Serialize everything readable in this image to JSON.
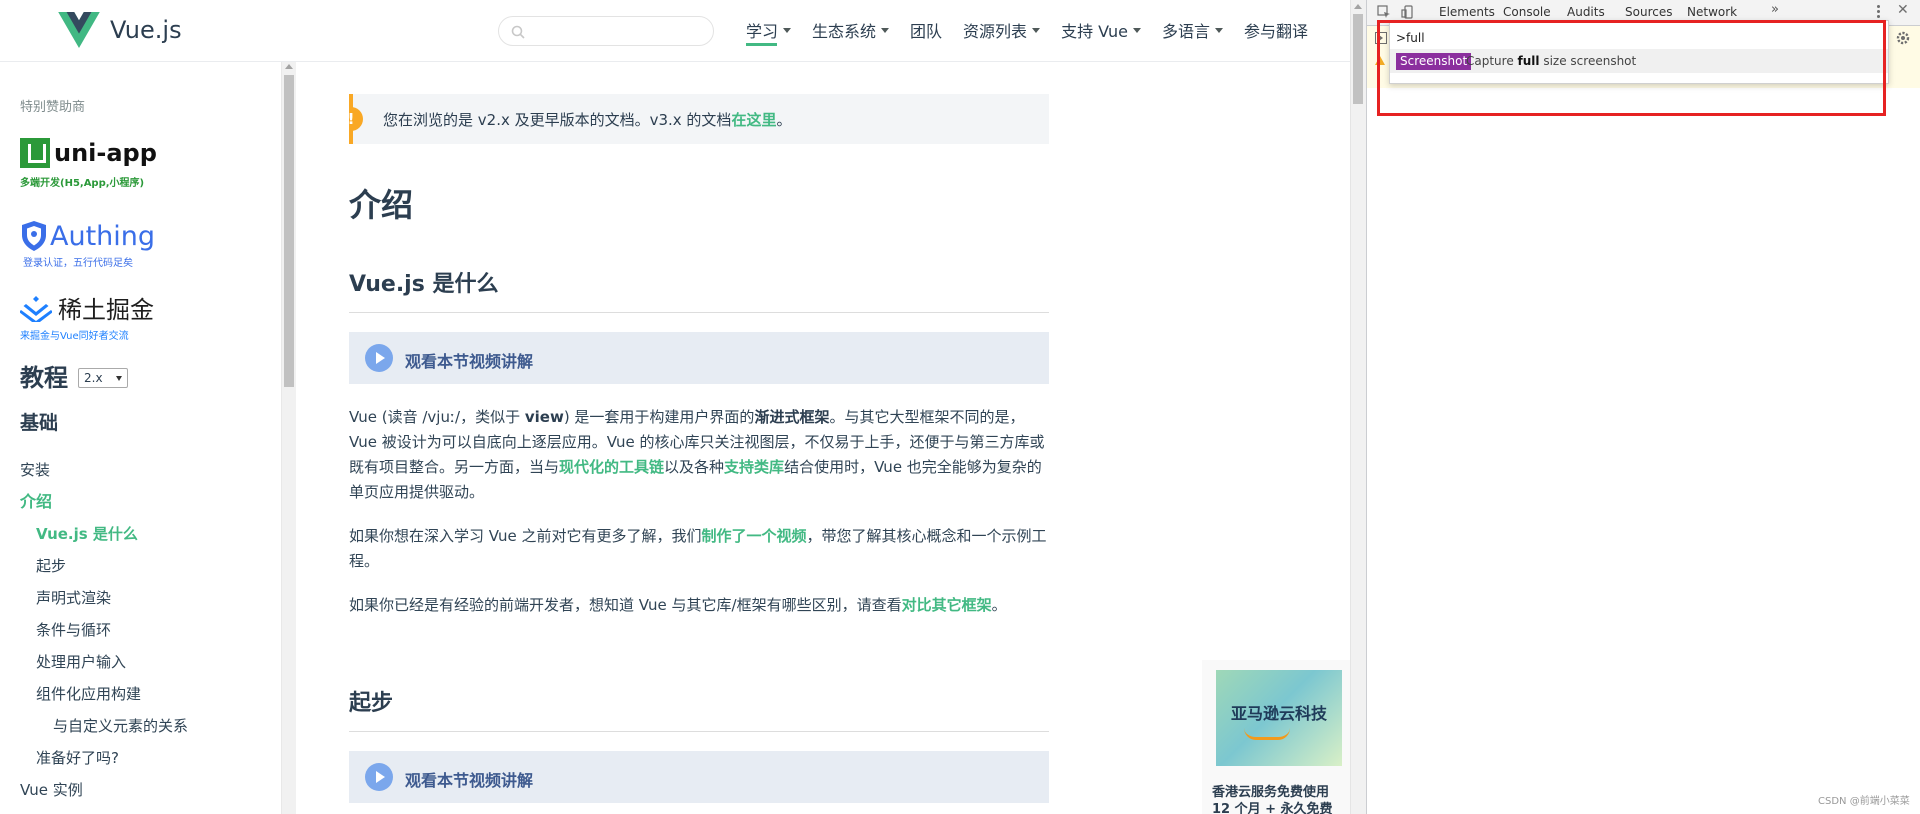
{
  "header": {
    "logo_text": "Vue.js",
    "search": {
      "placeholder": "",
      "value": ""
    },
    "nav": [
      {
        "label": "学习",
        "dropdown": true,
        "active": true
      },
      {
        "label": "生态系统",
        "dropdown": true
      },
      {
        "label": "团队",
        "dropdown": false
      },
      {
        "label": "资源列表",
        "dropdown": true
      },
      {
        "label": "支持 Vue",
        "dropdown": true
      },
      {
        "label": "多语言",
        "dropdown": true
      },
      {
        "label": "参与翻译",
        "dropdown": false
      }
    ]
  },
  "sidebar": {
    "sponsor_heading": "特别赞助商",
    "sponsors": [
      {
        "name": "uni-app",
        "tagline": "多端开发(H5,App,小程序)",
        "icon": "uni-app-logo-icon",
        "color": "#2b9939"
      },
      {
        "name": "Authing",
        "tagline": "登录认证，五行代码足矣",
        "icon": "authing-shield-icon",
        "color": "#3a6ee8"
      },
      {
        "name": "稀土掘金",
        "tagline": "来掘金与Vue同好者交流",
        "icon": "juejin-logo-icon",
        "color": "#1e80ff"
      }
    ],
    "toc_title": "教程",
    "version": "2.x",
    "section": "基础",
    "links": [
      {
        "label": "安装",
        "level": 0,
        "state": ""
      },
      {
        "label": "介绍",
        "level": 0,
        "state": "active"
      },
      {
        "label": "Vue.js 是什么",
        "level": 1,
        "state": "current"
      },
      {
        "label": "起步",
        "level": 1,
        "state": ""
      },
      {
        "label": "声明式渲染",
        "level": 1,
        "state": ""
      },
      {
        "label": "条件与循环",
        "level": 1,
        "state": ""
      },
      {
        "label": "处理用户输入",
        "level": 1,
        "state": ""
      },
      {
        "label": "组件化应用构建",
        "level": 1,
        "state": ""
      },
      {
        "label": "与自定义元素的关系",
        "level": 2,
        "state": ""
      },
      {
        "label": "准备好了吗?",
        "level": 1,
        "state": ""
      },
      {
        "label": "Vue 实例",
        "level": 0,
        "state": ""
      }
    ]
  },
  "main": {
    "notice": {
      "text": "您在浏览的是 v2.x 及更早版本的文档。v3.x 的文档",
      "link": "在这里",
      "end": "。"
    },
    "title": "介绍",
    "section1": {
      "heading": "Vue.js 是什么",
      "video_label": "观看本节视频讲解",
      "p1": [
        {
          "t": "Vue (读音 /vjuː/，类似于 "
        },
        {
          "t": "view",
          "b": true
        },
        {
          "t": ") 是一套用于构建用户界面的"
        },
        {
          "t": "渐进式框架",
          "b": true
        },
        {
          "t": "。与其它大型框架不同的是，Vue 被设计为可以自底向上逐层应用。Vue 的核心库只关注视图层，不仅易于上手，还便于与第三方库或既有项目整合。另一方面，当与"
        },
        {
          "t": "现代化的工具链",
          "a": true
        },
        {
          "t": "以及各种"
        },
        {
          "t": "支持类库",
          "a": true
        },
        {
          "t": "结合使用时，Vue 也完全能够为复杂的单页应用提供驱动。"
        }
      ],
      "p2": [
        {
          "t": "如果你想在深入学习 Vue 之前对它有更多了解，我们"
        },
        {
          "t": "制作了一个视频",
          "a": true
        },
        {
          "t": "，带您了解其核心概念和一个示例工程。"
        }
      ],
      "p3": [
        {
          "t": "如果你已经是有经验的前端开发者，想知道 Vue 与其它库/框架有哪些区别，请查看"
        },
        {
          "t": "对比其它框架",
          "a": true
        },
        {
          "t": "。"
        }
      ]
    },
    "section2": {
      "heading": "起步",
      "video_label": "观看本节视频讲解"
    }
  },
  "ad": {
    "brand": "亚马逊云科技",
    "text": "香港云服务免费使用 12 个月 + 永久免费"
  },
  "devtools": {
    "tabs": [
      "Elements",
      "Console",
      "Audits",
      "Sources",
      "Network"
    ],
    "active_tab": "Console",
    "more_label": "»",
    "close_label": "✕",
    "command_input": ">full",
    "command_result": {
      "badge": "Screenshot",
      "desc_before": "Capture ",
      "desc_match": "full",
      "desc_after": " size screenshot"
    }
  },
  "watermark": "CSDN @前端小菜菜",
  "colors": {
    "accent": "#42b983",
    "highlight": "#e62222",
    "badge": "#8b2f9e"
  }
}
